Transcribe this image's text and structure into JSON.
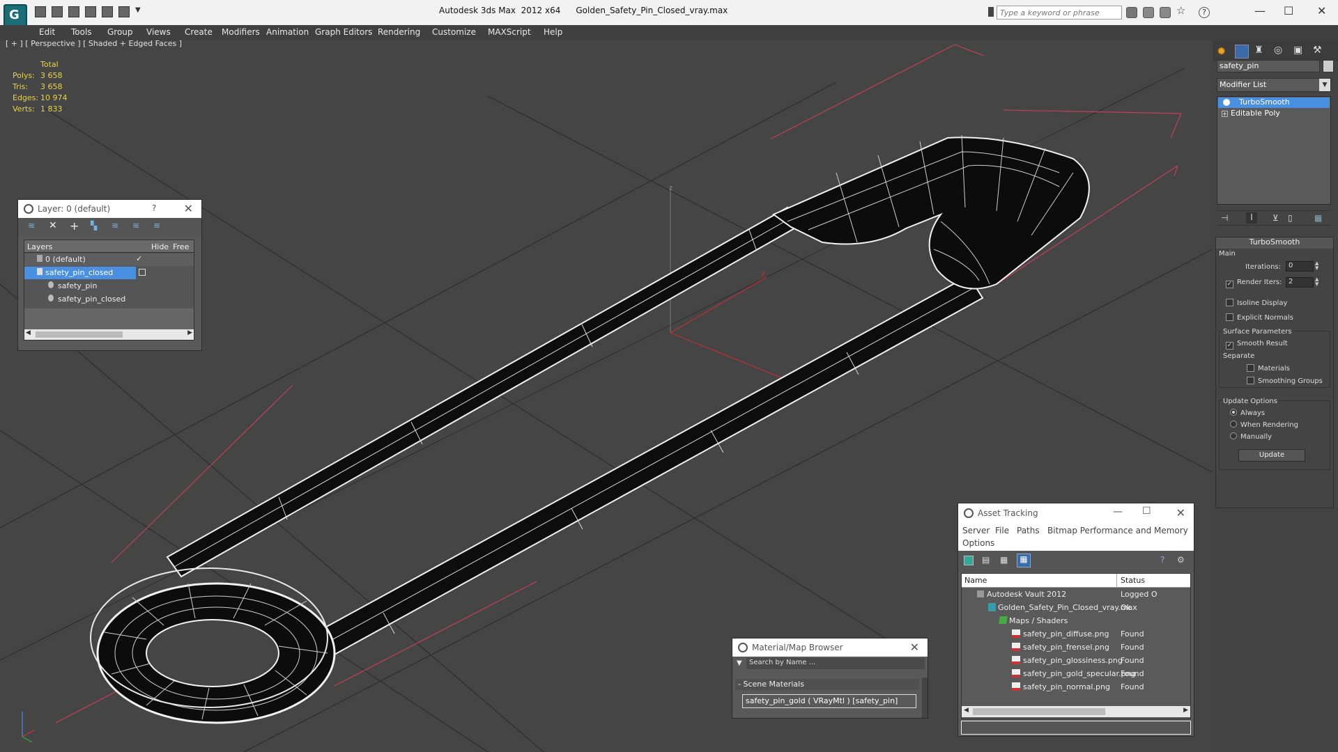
{
  "app": {
    "title": "Autodesk 3ds Max  2012 x64",
    "file": "Golden_Safety_Pin_Closed_vray.max",
    "search_placeholder": "Type a keyword or phrase"
  },
  "menu": [
    "Edit",
    "Tools",
    "Group",
    "Views",
    "Create",
    "Modifiers",
    "Animation",
    "Graph Editors",
    "Rendering",
    "Customize",
    "MAXScript",
    "Help"
  ],
  "viewport": {
    "label": "[ + ] [ Perspective ] [ Shaded + Edged Faces ]",
    "stats_header": "Total",
    "stats": [
      {
        "label": "Polys:",
        "value": "3 658"
      },
      {
        "label": "Tris:",
        "value": "3 658"
      },
      {
        "label": "Edges:",
        "value": "10 974"
      },
      {
        "label": "Verts:",
        "value": "1 833"
      }
    ],
    "axis_y": "y",
    "axis_z": "z"
  },
  "command_panel": {
    "object_name": "safety_pin",
    "modifier_list": "Modifier List",
    "stack": [
      "TurboSmooth",
      "Editable Poly"
    ],
    "rollout_title": "TurboSmooth",
    "main_group": "Main",
    "iterations_label": "Iterations:",
    "iterations_value": "0",
    "render_iters_label": "Render Iters:",
    "render_iters_value": "2",
    "isoline": "Isoline Display",
    "explicit_normals": "Explicit Normals",
    "surface_group": "Surface Parameters",
    "smooth_result": "Smooth Result",
    "separate": "Separate",
    "materials": "Materials",
    "smoothing_groups": "Smoothing Groups",
    "update_group": "Update Options",
    "always": "Always",
    "when_rendering": "When Rendering",
    "manually": "Manually",
    "update_button": "Update"
  },
  "layer_window": {
    "title": "Layer: 0 (default)",
    "help": "?",
    "col_layers": "Layers",
    "col_hide": "Hide",
    "col_freeze": "Free",
    "rows": [
      {
        "label": "0 (default)",
        "indent": 1,
        "selected": false
      },
      {
        "label": "safety_pin_closed",
        "indent": 1,
        "selected": true
      },
      {
        "label": "safety_pin",
        "indent": 2,
        "selected": false
      },
      {
        "label": "safety_pin_closed",
        "indent": 2,
        "selected": false
      }
    ]
  },
  "asset_tracking": {
    "title": "Asset Tracking",
    "menu": [
      "Server",
      "File",
      "Paths",
      "Bitmap Performance and Memory"
    ],
    "menu2": "Options",
    "col_name": "Name",
    "col_status": "Status",
    "rows": [
      {
        "name": "Autodesk Vault 2012",
        "status": "Logged O",
        "indent": 0
      },
      {
        "name": "Golden_Safety_Pin_Closed_vray.max",
        "status": "Ok",
        "indent": 1
      },
      {
        "name": "Maps / Shaders",
        "status": "",
        "indent": 2
      },
      {
        "name": "safety_pin_diffuse.png",
        "status": "Found",
        "indent": 3
      },
      {
        "name": "safety_pin_frensel.png",
        "status": "Found",
        "indent": 3
      },
      {
        "name": "safety_pin_glossiness.png",
        "status": "Found",
        "indent": 3
      },
      {
        "name": "safety_pin_gold_specular.png",
        "status": "Found",
        "indent": 3
      },
      {
        "name": "safety_pin_normal.png",
        "status": "Found",
        "indent": 3
      }
    ]
  },
  "material_browser": {
    "title": "Material/Map Browser",
    "search": "Search by Name ...",
    "section": "Scene Materials",
    "item": "safety_pin_gold  ( VRayMtl ) [safety_pin]"
  }
}
